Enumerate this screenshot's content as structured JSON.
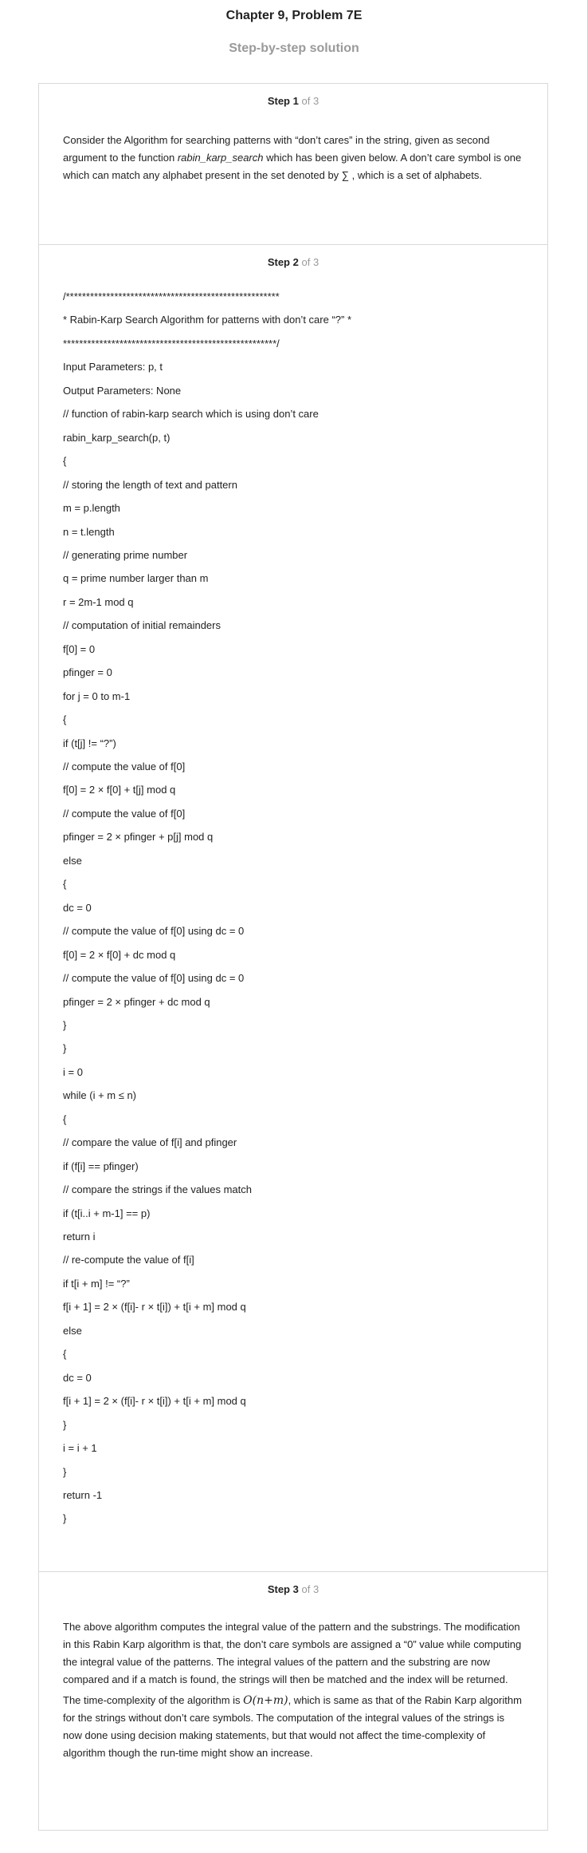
{
  "header": {
    "title": "Chapter 9, Problem 7E",
    "subtitle": "Step-by-step solution"
  },
  "step_label": "Step",
  "step_total": "of 3",
  "steps": [
    {
      "number": "1",
      "paragraphs": [
        {
          "t1": "Consider the Algorithm for searching patterns with “don’t cares” in the string, given as second argument to the function ",
          "fn": "rabin_karp_search",
          "t2": " which has been given below. A don’t care symbol is one which can match any alphabet present in the set denoted by ∑ , which is a set of alphabets."
        }
      ]
    },
    {
      "number": "2",
      "code": [
        "/*****************************************************",
        "* Rabin-Karp Search Algorithm for patterns with don’t care “?” *",
        "*****************************************************/",
        "Input Parameters: p, t",
        "Output Parameters: None",
        "// function of rabin-karp search which is using don’t care",
        "rabin_karp_search(p, t)",
        "{",
        "// storing the length of text and pattern",
        "m = p.length",
        "n = t.length",
        "// generating prime number",
        "q = prime number larger than m",
        "r = 2m-1 mod q",
        "// computation of initial remainders",
        "f[0] = 0",
        "pfinger = 0",
        "for j = 0 to m-1",
        "{",
        "if (t[j] != “?”)",
        "// compute the value of f[0]",
        "f[0] = 2 × f[0] + t[j] mod q",
        "// compute the value of f[0]",
        "pfinger = 2 × pfinger + p[j] mod q",
        "else",
        "{",
        "dc = 0",
        "// compute the value of f[0] using dc = 0",
        "f[0] = 2 × f[0] + dc mod q",
        "// compute the value of f[0] using dc = 0",
        "pfinger = 2 × pfinger + dc mod q",
        "}",
        "}",
        "i = 0",
        "while (i + m ≤ n)",
        "{",
        "// compare the value of f[i] and pfinger",
        "if (f[i] == pfinger)",
        "// compare the strings if the values match",
        "if (t[i..i + m-1] == p)",
        "return i",
        "// re-compute the value of f[i]",
        "if t[i + m] != “?”",
        "f[i + 1] = 2 × (f[i]- r × t[i]) + t[i + m] mod q",
        "else",
        "{",
        "dc = 0",
        "f[i + 1] = 2 × (f[i]- r × t[i]) + t[i + m] mod q",
        "}",
        "i = i + 1",
        "}",
        "return -1",
        "}"
      ]
    },
    {
      "number": "3",
      "paragraphs": [
        {
          "t1": "The above algorithm computes the integral value of the pattern and the substrings. The modification in this Rabin Karp algorithm is that, the don’t care symbols are assigned a “0” value while computing the integral value of the patterns. The integral values of the pattern and the substring are now compared and if a match is found, the strings will then be matched and the index will be returned."
        },
        {
          "t1": "The time-complexity of the algorithm is ",
          "math": "O(n+m)",
          "t2": ", which is same as that of the Rabin Karp algorithm for the strings without don’t care symbols. The computation of the integral values of the strings is now done using decision making statements, but that would not affect the time-complexity of algorithm though the run-time might show an increase."
        }
      ]
    }
  ]
}
